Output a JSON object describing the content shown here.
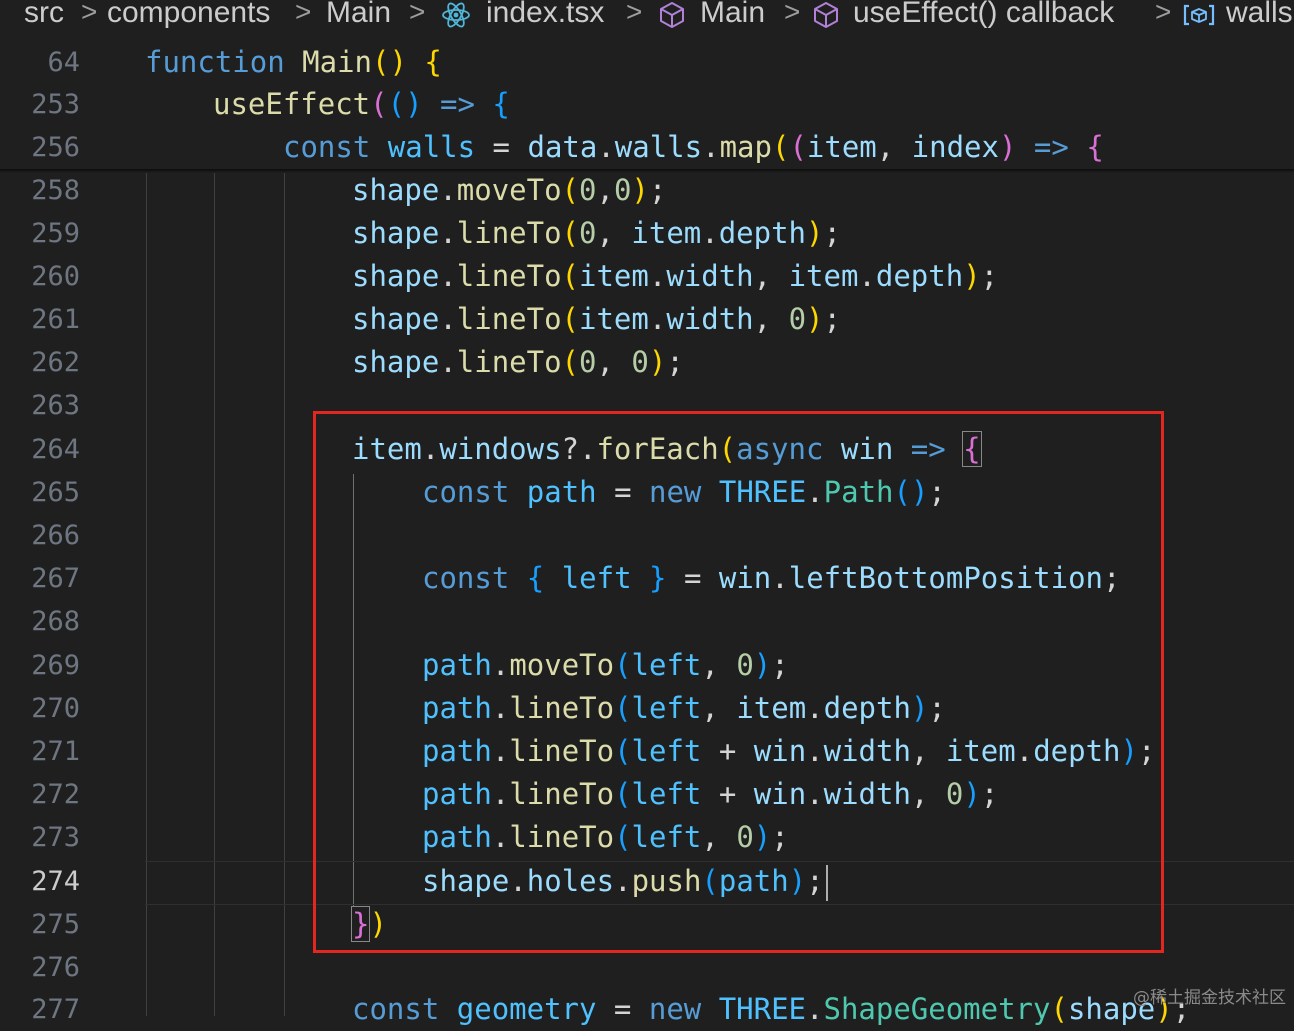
{
  "breadcrumb": {
    "items": [
      {
        "label": "src",
        "icon": null
      },
      {
        "label": "components",
        "icon": null
      },
      {
        "label": "Main",
        "icon": null
      },
      {
        "label": "index.tsx",
        "icon": "react-icon"
      },
      {
        "label": "Main",
        "icon": "cube-icon"
      },
      {
        "label": "useEffect() callback",
        "icon": "cube-icon"
      },
      {
        "label": "walls",
        "icon": "variable-icon"
      }
    ],
    "separator": ">"
  },
  "editor": {
    "active_line": "274",
    "lines": [
      {
        "number": "64",
        "tokens": [
          [
            "function",
            "k"
          ],
          [
            " ",
            "o"
          ],
          [
            "Main",
            "f"
          ],
          [
            "()",
            "p1"
          ],
          [
            " ",
            "o"
          ],
          [
            "{",
            "p1"
          ]
        ]
      },
      {
        "number": "253",
        "tokens": [
          [
            "useEffect",
            "f"
          ],
          [
            "(",
            "p2"
          ],
          [
            "()",
            "p3"
          ],
          [
            " ",
            "o"
          ],
          [
            "=>",
            "k"
          ],
          [
            " ",
            "o"
          ],
          [
            "{",
            "p3"
          ]
        ]
      },
      {
        "number": "256",
        "tokens": [
          [
            "const",
            "k"
          ],
          [
            " ",
            "o"
          ],
          [
            "walls",
            "c"
          ],
          [
            " = ",
            "o"
          ],
          [
            "data",
            "v"
          ],
          [
            ".",
            "o"
          ],
          [
            "walls",
            "v"
          ],
          [
            ".",
            "o"
          ],
          [
            "map",
            "f"
          ],
          [
            "(",
            "p1"
          ],
          [
            "(",
            "p2"
          ],
          [
            "item",
            "v"
          ],
          [
            ", ",
            "o"
          ],
          [
            "index",
            "v"
          ],
          [
            ")",
            "p2"
          ],
          [
            " ",
            "o"
          ],
          [
            "=>",
            "k"
          ],
          [
            " ",
            "o"
          ],
          [
            "{",
            "p2"
          ]
        ]
      },
      {
        "number": "258",
        "tokens": [
          [
            "shape",
            "v"
          ],
          [
            ".",
            "o"
          ],
          [
            "moveTo",
            "f"
          ],
          [
            "(",
            "p1"
          ],
          [
            "0",
            "n"
          ],
          [
            ",",
            "o"
          ],
          [
            "0",
            "n"
          ],
          [
            ")",
            "p1"
          ],
          [
            ";",
            "o"
          ]
        ]
      },
      {
        "number": "259",
        "tokens": [
          [
            "shape",
            "v"
          ],
          [
            ".",
            "o"
          ],
          [
            "lineTo",
            "f"
          ],
          [
            "(",
            "p1"
          ],
          [
            "0",
            "n"
          ],
          [
            ", ",
            "o"
          ],
          [
            "item",
            "v"
          ],
          [
            ".",
            "o"
          ],
          [
            "depth",
            "v"
          ],
          [
            ")",
            "p1"
          ],
          [
            ";",
            "o"
          ]
        ]
      },
      {
        "number": "260",
        "tokens": [
          [
            "shape",
            "v"
          ],
          [
            ".",
            "o"
          ],
          [
            "lineTo",
            "f"
          ],
          [
            "(",
            "p1"
          ],
          [
            "item",
            "v"
          ],
          [
            ".",
            "o"
          ],
          [
            "width",
            "v"
          ],
          [
            ", ",
            "o"
          ],
          [
            "item",
            "v"
          ],
          [
            ".",
            "o"
          ],
          [
            "depth",
            "v"
          ],
          [
            ")",
            "p1"
          ],
          [
            ";",
            "o"
          ]
        ]
      },
      {
        "number": "261",
        "tokens": [
          [
            "shape",
            "v"
          ],
          [
            ".",
            "o"
          ],
          [
            "lineTo",
            "f"
          ],
          [
            "(",
            "p1"
          ],
          [
            "item",
            "v"
          ],
          [
            ".",
            "o"
          ],
          [
            "width",
            "v"
          ],
          [
            ", ",
            "o"
          ],
          [
            "0",
            "n"
          ],
          [
            ")",
            "p1"
          ],
          [
            ";",
            "o"
          ]
        ]
      },
      {
        "number": "262",
        "tokens": [
          [
            "shape",
            "v"
          ],
          [
            ".",
            "o"
          ],
          [
            "lineTo",
            "f"
          ],
          [
            "(",
            "p1"
          ],
          [
            "0",
            "n"
          ],
          [
            ", ",
            "o"
          ],
          [
            "0",
            "n"
          ],
          [
            ")",
            "p1"
          ],
          [
            ";",
            "o"
          ]
        ]
      },
      {
        "number": "263",
        "tokens": []
      },
      {
        "number": "264",
        "tokens": [
          [
            "item",
            "v"
          ],
          [
            ".",
            "o"
          ],
          [
            "windows",
            "v"
          ],
          [
            "?.",
            "o"
          ],
          [
            "forEach",
            "f"
          ],
          [
            "(",
            "p1"
          ],
          [
            "async",
            "k"
          ],
          [
            " ",
            "o"
          ],
          [
            "win",
            "v"
          ],
          [
            " ",
            "o"
          ],
          [
            "=>",
            "k"
          ],
          [
            " ",
            "o"
          ],
          [
            "{",
            "p2"
          ]
        ]
      },
      {
        "number": "265",
        "tokens": [
          [
            "const",
            "k"
          ],
          [
            " ",
            "o"
          ],
          [
            "path",
            "c"
          ],
          [
            " = ",
            "o"
          ],
          [
            "new",
            "k"
          ],
          [
            " ",
            "o"
          ],
          [
            "THREE",
            "c"
          ],
          [
            ".",
            "o"
          ],
          [
            "Path",
            "t"
          ],
          [
            "()",
            "p3"
          ],
          [
            ";",
            "o"
          ]
        ]
      },
      {
        "number": "266",
        "tokens": []
      },
      {
        "number": "267",
        "tokens": [
          [
            "const",
            "k"
          ],
          [
            " ",
            "o"
          ],
          [
            "{",
            "p3"
          ],
          [
            " ",
            "o"
          ],
          [
            "left",
            "c"
          ],
          [
            " ",
            "o"
          ],
          [
            "}",
            "p3"
          ],
          [
            " = ",
            "o"
          ],
          [
            "win",
            "v"
          ],
          [
            ".",
            "o"
          ],
          [
            "leftBottomPosition",
            "v"
          ],
          [
            ";",
            "o"
          ]
        ]
      },
      {
        "number": "268",
        "tokens": []
      },
      {
        "number": "269",
        "tokens": [
          [
            "path",
            "c"
          ],
          [
            ".",
            "o"
          ],
          [
            "moveTo",
            "f"
          ],
          [
            "(",
            "p3"
          ],
          [
            "left",
            "c"
          ],
          [
            ", ",
            "o"
          ],
          [
            "0",
            "n"
          ],
          [
            ")",
            "p3"
          ],
          [
            ";",
            "o"
          ]
        ]
      },
      {
        "number": "270",
        "tokens": [
          [
            "path",
            "c"
          ],
          [
            ".",
            "o"
          ],
          [
            "lineTo",
            "f"
          ],
          [
            "(",
            "p3"
          ],
          [
            "left",
            "c"
          ],
          [
            ", ",
            "o"
          ],
          [
            "item",
            "v"
          ],
          [
            ".",
            "o"
          ],
          [
            "depth",
            "v"
          ],
          [
            ")",
            "p3"
          ],
          [
            ";",
            "o"
          ]
        ]
      },
      {
        "number": "271",
        "tokens": [
          [
            "path",
            "c"
          ],
          [
            ".",
            "o"
          ],
          [
            "lineTo",
            "f"
          ],
          [
            "(",
            "p3"
          ],
          [
            "left",
            "c"
          ],
          [
            " + ",
            "o"
          ],
          [
            "win",
            "v"
          ],
          [
            ".",
            "o"
          ],
          [
            "width",
            "v"
          ],
          [
            ", ",
            "o"
          ],
          [
            "item",
            "v"
          ],
          [
            ".",
            "o"
          ],
          [
            "depth",
            "v"
          ],
          [
            ")",
            "p3"
          ],
          [
            ";",
            "o"
          ]
        ]
      },
      {
        "number": "272",
        "tokens": [
          [
            "path",
            "c"
          ],
          [
            ".",
            "o"
          ],
          [
            "lineTo",
            "f"
          ],
          [
            "(",
            "p3"
          ],
          [
            "left",
            "c"
          ],
          [
            " + ",
            "o"
          ],
          [
            "win",
            "v"
          ],
          [
            ".",
            "o"
          ],
          [
            "width",
            "v"
          ],
          [
            ", ",
            "o"
          ],
          [
            "0",
            "n"
          ],
          [
            ")",
            "p3"
          ],
          [
            ";",
            "o"
          ]
        ]
      },
      {
        "number": "273",
        "tokens": [
          [
            "path",
            "c"
          ],
          [
            ".",
            "o"
          ],
          [
            "lineTo",
            "f"
          ],
          [
            "(",
            "p3"
          ],
          [
            "left",
            "c"
          ],
          [
            ", ",
            "o"
          ],
          [
            "0",
            "n"
          ],
          [
            ")",
            "p3"
          ],
          [
            ";",
            "o"
          ]
        ]
      },
      {
        "number": "274",
        "tokens": [
          [
            "shape",
            "v"
          ],
          [
            ".",
            "o"
          ],
          [
            "holes",
            "v"
          ],
          [
            ".",
            "o"
          ],
          [
            "push",
            "f"
          ],
          [
            "(",
            "p3"
          ],
          [
            "path",
            "c"
          ],
          [
            ")",
            "p3"
          ],
          [
            ";",
            "o"
          ]
        ]
      },
      {
        "number": "275",
        "tokens": [
          [
            "}",
            "p2"
          ],
          [
            ")",
            "p1"
          ]
        ]
      },
      {
        "number": "276",
        "tokens": []
      },
      {
        "number": "277",
        "tokens": [
          [
            "const",
            "k"
          ],
          [
            " ",
            "o"
          ],
          [
            "geometry",
            "c"
          ],
          [
            " = ",
            "o"
          ],
          [
            "new",
            "k"
          ],
          [
            " ",
            "o"
          ],
          [
            "THREE",
            "c"
          ],
          [
            ".",
            "o"
          ],
          [
            "ShapeGeometry",
            "t"
          ],
          [
            "(",
            "p1"
          ],
          [
            "shape",
            "v"
          ],
          [
            ")",
            "p1"
          ],
          [
            ";",
            "o"
          ]
        ]
      }
    ]
  },
  "colors": {
    "highlight_box": "#e3261f",
    "keyword": "#569cd6",
    "function": "#dcdcaa",
    "variable": "#9cdcfe",
    "constant": "#4fc1ff",
    "type": "#4ec9b0",
    "number": "#b5cea8"
  },
  "watermark": "@稀土掘金技术社区"
}
